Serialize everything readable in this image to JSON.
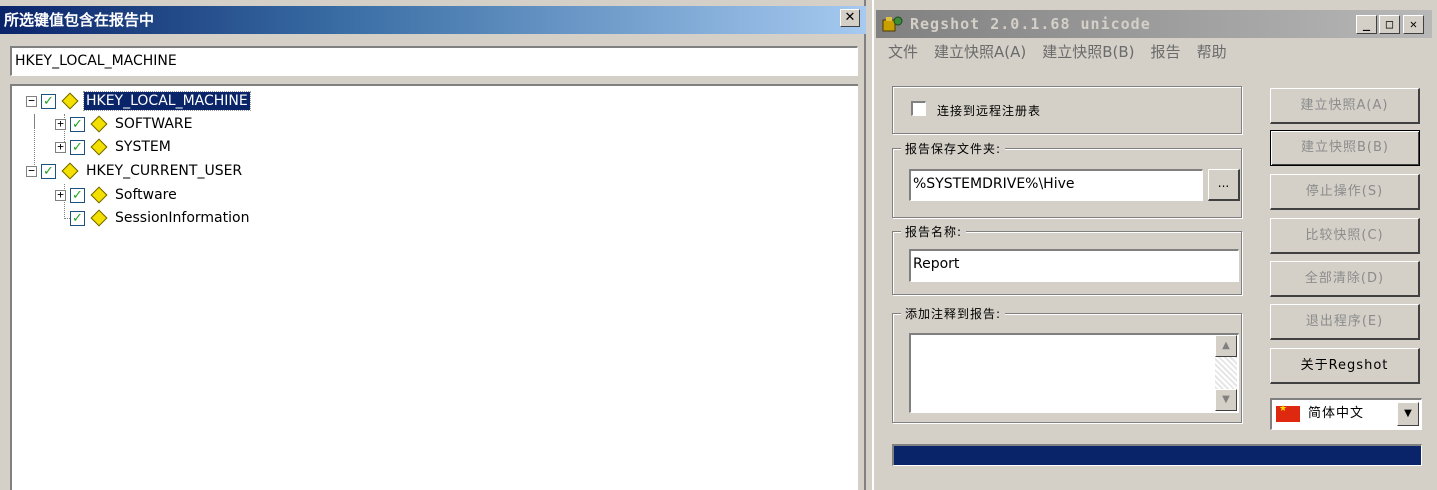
{
  "left_window": {
    "title": "所选键值包含在报告中",
    "path_value": "HKEY_LOCAL_MACHINE",
    "tree": [
      {
        "label": "HKEY_LOCAL_MACHINE",
        "checked": true,
        "expanded": true,
        "selected": true
      },
      {
        "label": "SOFTWARE",
        "checked": true,
        "expanded": false
      },
      {
        "label": "SYSTEM",
        "checked": true,
        "expanded": false
      },
      {
        "label": "HKEY_CURRENT_USER",
        "checked": true,
        "expanded": true
      },
      {
        "label": "Software",
        "checked": true,
        "expanded": false
      },
      {
        "label": "SessionInformation",
        "checked": true,
        "expanded": null
      }
    ]
  },
  "regshot": {
    "title": "Regshot 2.0.1.68 unicode",
    "menu": [
      "文件",
      "建立快照A(A)",
      "建立快照B(B)",
      "报告",
      "帮助"
    ],
    "remote_label": "连接到远程注册表",
    "remote_checked": false,
    "folder_caption": "报告保存文件夹:",
    "folder_value": "%SYSTEMDRIVE%\\Hive",
    "browse_label": "...",
    "name_caption": "报告名称:",
    "name_value": "Report",
    "comment_caption": "添加注释到报告:",
    "comment_value": "",
    "buttons": {
      "shot_a": "建立快照A(A)",
      "shot_b": "建立快照B(B)",
      "stop": "停止操作(S)",
      "compare": "比较快照(C)",
      "clear": "全部清除(D)",
      "quit": "退出程序(E)",
      "about": "关于Regshot"
    },
    "language": "简体中文",
    "progress": 1.0
  },
  "colors": {
    "title_active": "#0a246a",
    "title_inactive": "#808080",
    "face": "#d4d0c8",
    "check_green": "#21a121",
    "key_yellow": "#f3e000",
    "progress": "#0a246a"
  }
}
